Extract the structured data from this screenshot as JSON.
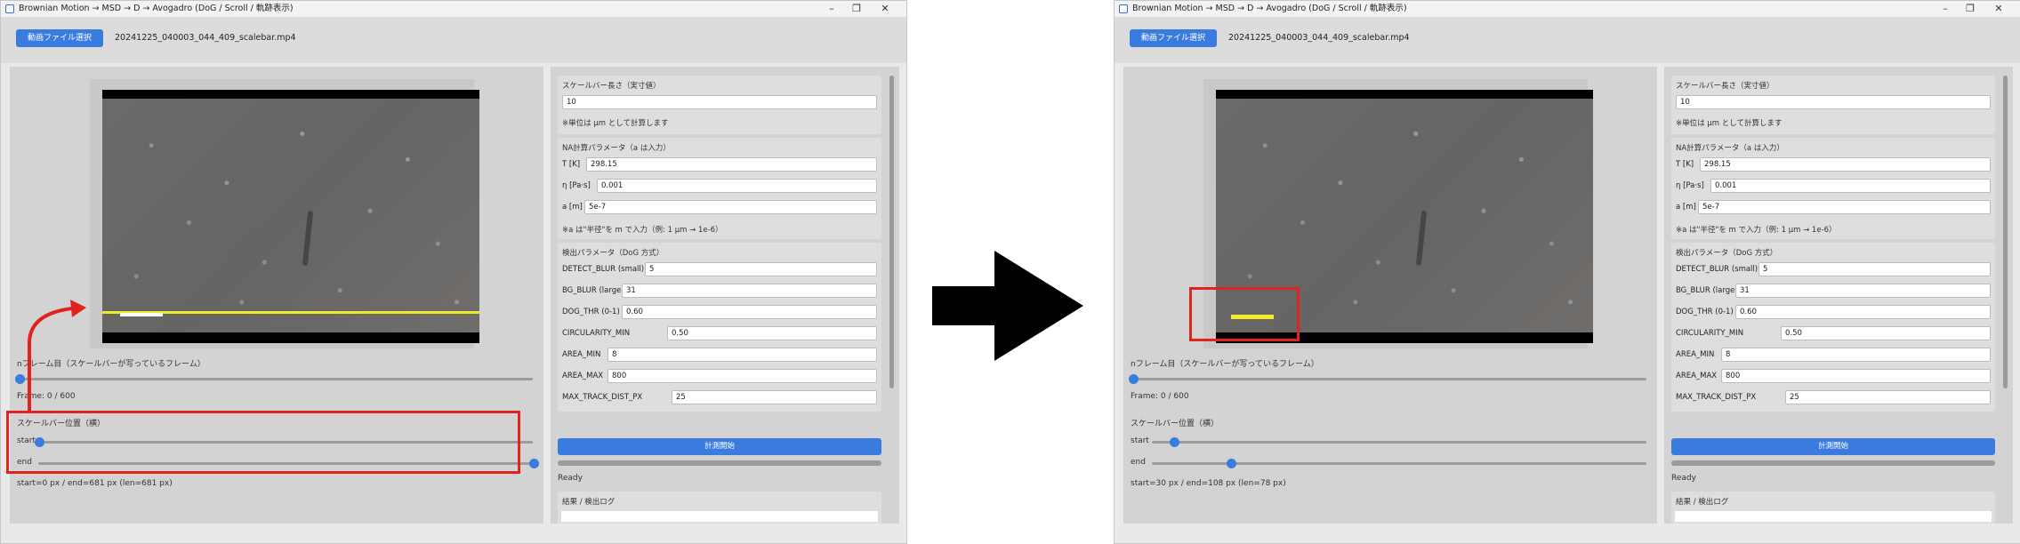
{
  "windows": [
    {
      "title": "Brownian Motion → MSD → D → Avogadro (DoG / Scroll / 軌跡表示)",
      "file_button": "動画ファイル選択",
      "file_name": "20241225_040003_044_409_scalebar.mp4",
      "frame_label": "nフレーム目（スケールバーが写っているフレーム）",
      "frame_text": "Frame: 0 / 600",
      "frame_position": 0.0,
      "scalebar_section": "スケールバー位置（横）",
      "start_label": "start",
      "end_label": "end",
      "start_position": 0.0,
      "end_position": 1.0,
      "range_text": "start=0 px / end=681 px (len=681 px)",
      "scale_length_title": "スケールバー長さ（実寸値）",
      "scale_length_value": "10",
      "unit_note": "※単位は μm として計算します",
      "na_title": "NA計算パラメータ（a は入力）",
      "params_a": [
        {
          "label": "T [K]",
          "value": "298.15"
        },
        {
          "label": "η [Pa·s]",
          "value": "0.001"
        },
        {
          "label": "a [m]",
          "value": "5e-7"
        }
      ],
      "a_note": "※a は\"半径\"を m で入力（例: 1 μm → 1e-6）",
      "detect_title": "検出パラメータ（DoG 方式）",
      "detect_params": [
        {
          "label": "DETECT_BLUR (small)",
          "value": "5"
        },
        {
          "label": "BG_BLUR (large)",
          "value": "31"
        },
        {
          "label": "DOG_THR (0-1)",
          "value": "0.60"
        },
        {
          "label": "CIRCULARITY_MIN",
          "value": "0.50"
        },
        {
          "label": "AREA_MIN",
          "value": "8"
        },
        {
          "label": "AREA_MAX",
          "value": "800"
        },
        {
          "label": "MAX_TRACK_DIST_PX",
          "value": "25"
        }
      ],
      "run_button": "計測開始",
      "status": "Ready",
      "log_title": "結果 / 検出ログ",
      "window_controls": [
        "–",
        "❐",
        "✕"
      ]
    },
    {
      "title": "Brownian Motion → MSD → D → Avogadro (DoG / Scroll / 軌跡表示)",
      "file_button": "動画ファイル選択",
      "file_name": "20241225_040003_044_409_scalebar.mp4",
      "frame_label": "nフレーム目（スケールバーが写っているフレーム）",
      "frame_text": "Frame: 0 / 600",
      "frame_position": 0.0,
      "scalebar_section": "スケールバー位置（横）",
      "start_label": "start",
      "end_label": "end",
      "start_position": 0.044,
      "end_position": 0.159,
      "range_text": "start=30 px / end=108 px (len=78 px)",
      "scale_length_title": "スケールバー長さ（実寸値）",
      "scale_length_value": "10",
      "unit_note": "※単位は μm として計算します",
      "na_title": "NA計算パラメータ（a は入力）",
      "params_a": [
        {
          "label": "T [K]",
          "value": "298.15"
        },
        {
          "label": "η [Pa·s]",
          "value": "0.001"
        },
        {
          "label": "a [m]",
          "value": "5e-7"
        }
      ],
      "a_note": "※a は\"半径\"を m で入力（例: 1 μm → 1e-6）",
      "detect_title": "検出パラメータ（DoG 方式）",
      "detect_params": [
        {
          "label": "DETECT_BLUR (small)",
          "value": "5"
        },
        {
          "label": "BG_BLUR (large)",
          "value": "31"
        },
        {
          "label": "DOG_THR (0-1)",
          "value": "0.60"
        },
        {
          "label": "CIRCULARITY_MIN",
          "value": "0.50"
        },
        {
          "label": "AREA_MIN",
          "value": "8"
        },
        {
          "label": "AREA_MAX",
          "value": "800"
        },
        {
          "label": "MAX_TRACK_DIST_PX",
          "value": "25"
        }
      ],
      "run_button": "計測開始",
      "status": "Ready",
      "log_title": "結果 / 検出ログ",
      "window_controls": [
        "–",
        "❐",
        "✕"
      ]
    }
  ],
  "colors": {
    "accent": "#3a7be0",
    "highlight": "#e0231f",
    "scale_line": "#f2ea27"
  }
}
